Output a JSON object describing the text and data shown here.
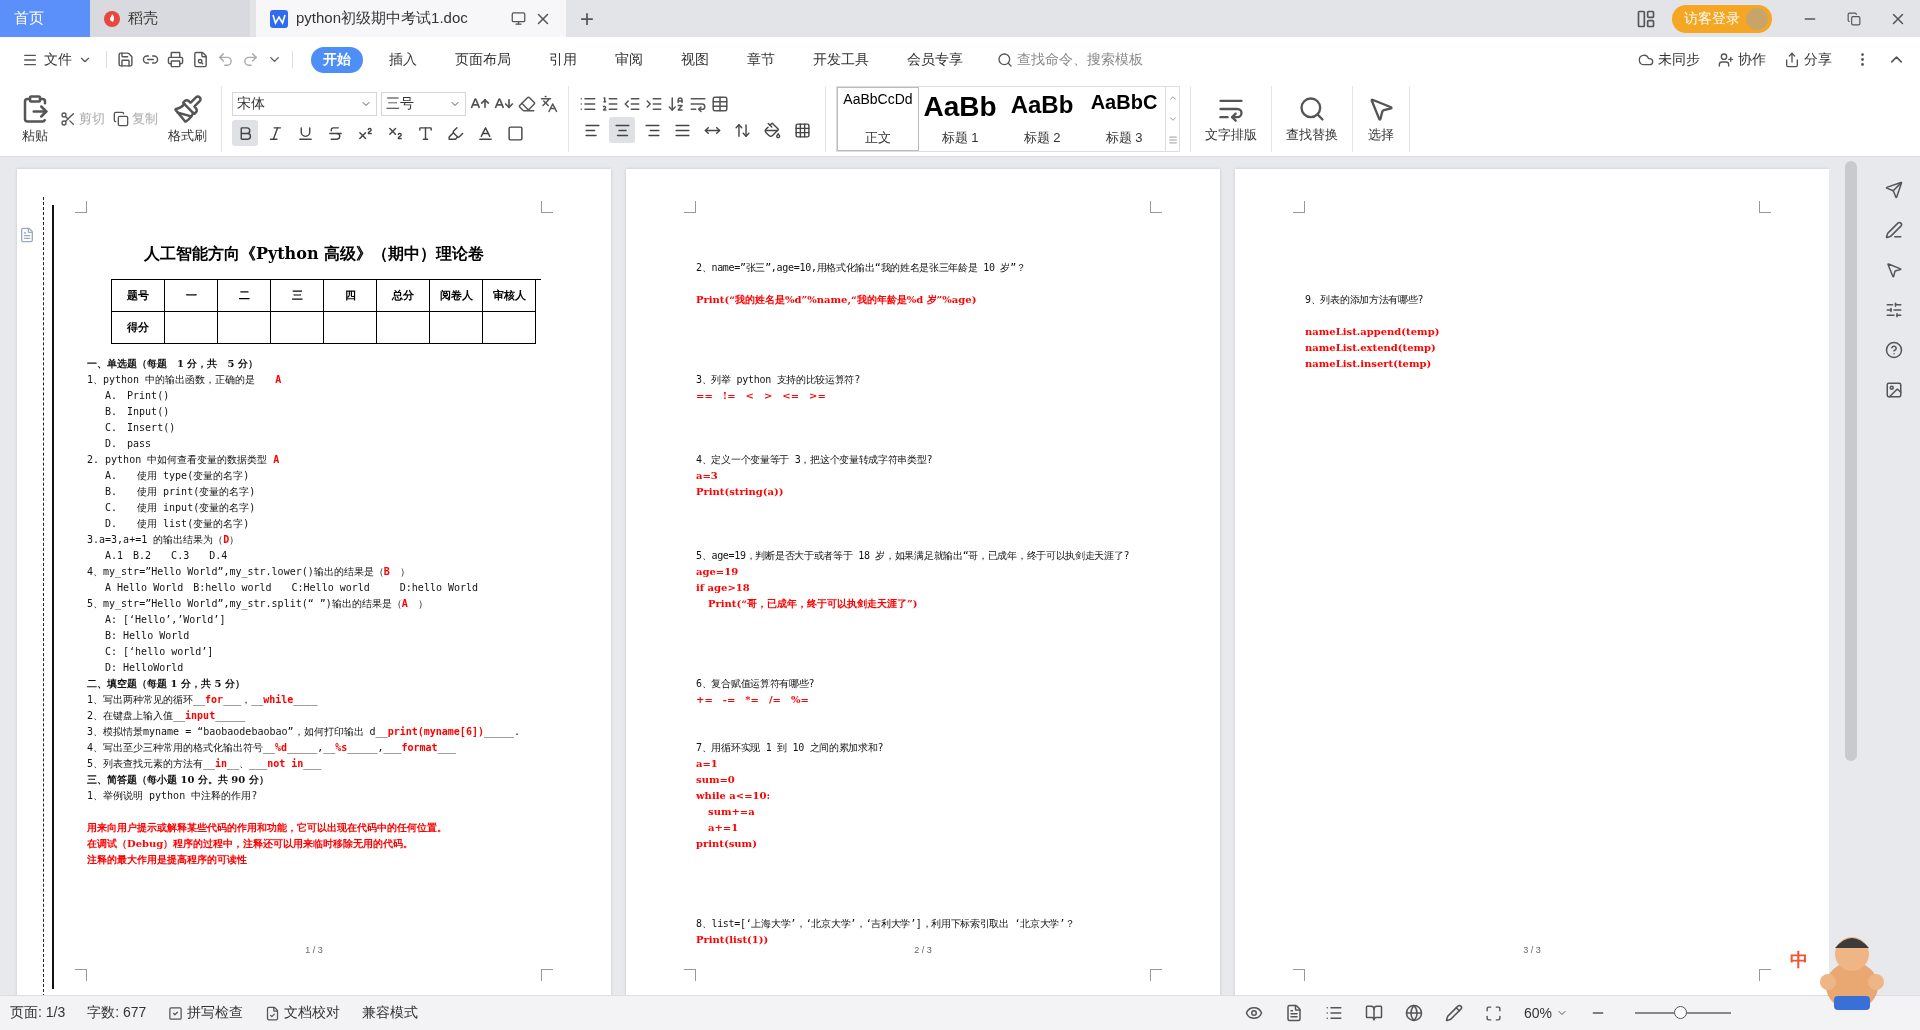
{
  "tabs": [
    {
      "label": "首页",
      "kind": "home",
      "selected": false
    },
    {
      "label": "稻壳",
      "kind": "app",
      "selected": false
    },
    {
      "label": "python初级期中考试1.doc",
      "kind": "doc",
      "selected": true
    }
  ],
  "new_tab": "+",
  "login_button": "访客登录",
  "menu": {
    "file": "文件",
    "items": [
      {
        "label": "开始",
        "selected": true
      },
      {
        "label": "插入",
        "selected": false
      },
      {
        "label": "页面布局",
        "selected": false
      },
      {
        "label": "引用",
        "selected": false
      },
      {
        "label": "审阅",
        "selected": false
      },
      {
        "label": "视图",
        "selected": false
      },
      {
        "label": "章节",
        "selected": false
      },
      {
        "label": "开发工具",
        "selected": false
      },
      {
        "label": "会员专享",
        "selected": false
      }
    ],
    "search_placeholder": "查找命令、搜索模板",
    "actions": [
      {
        "label": "未同步",
        "kind": "sync"
      },
      {
        "label": "协作",
        "kind": "collab"
      },
      {
        "label": "分享",
        "kind": "share"
      }
    ]
  },
  "ribbon": {
    "clipboard": [
      {
        "label": "粘贴",
        "kind": "paste",
        "disabled": false
      },
      {
        "label": "剪切",
        "kind": "cut",
        "disabled": true
      },
      {
        "label": "复制",
        "kind": "copy",
        "disabled": true
      },
      {
        "label": "格式刷",
        "kind": "brush",
        "disabled": false
      }
    ],
    "font": {
      "name": "宋体",
      "size": "三号"
    },
    "font_buttons": [
      {
        "kind": "bold",
        "selected": true
      },
      {
        "kind": "italic",
        "selected": false
      },
      {
        "kind": "underline",
        "selected": false
      },
      {
        "kind": "strike",
        "selected": false
      },
      {
        "kind": "sup",
        "selected": false
      },
      {
        "kind": "sub",
        "selected": false
      },
      {
        "kind": "effect",
        "selected": false
      },
      {
        "kind": "highlight",
        "selected": false
      },
      {
        "kind": "color",
        "selected": false
      },
      {
        "kind": "border",
        "selected": false
      }
    ],
    "paragraph_buttons": [
      {
        "kind": "left",
        "selected": false
      },
      {
        "kind": "center",
        "selected": true
      },
      {
        "kind": "right",
        "selected": false
      },
      {
        "kind": "justify",
        "selected": false
      },
      {
        "kind": "distribute",
        "selected": false
      },
      {
        "kind": "spacing",
        "selected": false
      },
      {
        "kind": "shading",
        "selected": false
      },
      {
        "kind": "borders",
        "selected": false
      }
    ],
    "styles": [
      {
        "preview": "AaBbCcDd",
        "label": "正文",
        "kind": "body",
        "selected": true
      },
      {
        "preview": "AaBb",
        "label": "标题 1",
        "kind": "h1",
        "selected": false
      },
      {
        "preview": "AaBb",
        "label": "标题 2",
        "kind": "h2",
        "selected": false
      },
      {
        "preview": "AaBbC",
        "label": "标题 3",
        "kind": "h3",
        "selected": false
      }
    ],
    "tools": [
      {
        "label": "文字排版",
        "kind": "layout"
      },
      {
        "label": "查找替换",
        "kind": "find"
      },
      {
        "label": "选择",
        "kind": "select"
      }
    ]
  },
  "pages": [
    {
      "number": "1 / 3",
      "binding": true,
      "lines": [
        {
          "kind": "title",
          "text": "人工智能方向《Python 高级》（期中）理论卷"
        },
        {
          "kind": "table",
          "header": [
            "题号",
            "一",
            "二",
            "三",
            "四",
            "总分",
            "阅卷人",
            "审核人"
          ],
          "row_label": "得分"
        },
        {
          "kind": "heading",
          "text": "一、单选题（每题　1 分，共　5 分）"
        },
        {
          "kind": "question",
          "parts": [
            {
              "text": "1、python 中的输出函数，正确的是　　",
              "answer": false
            },
            {
              "text": "A",
              "answer": true
            }
          ]
        },
        {
          "kind": "option",
          "text": "A.　Print()"
        },
        {
          "kind": "option",
          "text": "B.　Input()"
        },
        {
          "kind": "option",
          "text": "C.　Insert()"
        },
        {
          "kind": "option",
          "text": "D.　pass"
        },
        {
          "kind": "question",
          "parts": [
            {
              "text": "2. python 中如何查看变量的数据类型 ",
              "answer": false
            },
            {
              "text": "A",
              "answer": true
            }
          ]
        },
        {
          "kind": "option",
          "text": "A.　　使用 type(变量的名字)"
        },
        {
          "kind": "option",
          "text": "B.　　使用 print(变量的名字)"
        },
        {
          "kind": "option",
          "text": "C.　　使用 input(变量的名字)"
        },
        {
          "kind": "option",
          "text": "D.　　使用 list(变量的名字)"
        },
        {
          "kind": "question",
          "parts": [
            {
              "text": "3.a=3,a+=1 的输出结果为（",
              "answer": false
            },
            {
              "text": "D",
              "answer": true
            },
            {
              "text": "）",
              "answer": false
            }
          ]
        },
        {
          "kind": "option",
          "text": "A.1　B.2　　C.3　　D.4"
        },
        {
          "kind": "question",
          "parts": [
            {
              "text": "4、my_str=”Hello World”,my_str.lower()输出的结果是（",
              "answer": false
            },
            {
              "text": "B",
              "answer": true
            },
            {
              "text": "　）",
              "answer": false
            }
          ]
        },
        {
          "kind": "option",
          "text": "A Hello World　B:hello world　　C:Hello world　　　D:hello World"
        },
        {
          "kind": "question",
          "parts": [
            {
              "text": "5、my_str=”Hello World”,my_str.split(“ ”)输出的结果是（",
              "answer": false
            },
            {
              "text": "A",
              "answer": true
            },
            {
              "text": "　）",
              "answer": false
            }
          ]
        },
        {
          "kind": "option",
          "text": "A: [‘Hello’,’World’]"
        },
        {
          "kind": "option",
          "text": "B: Hello World"
        },
        {
          "kind": "option",
          "text": "C: [‘hello world’]"
        },
        {
          "kind": "option",
          "text": "D: HelloWorld"
        },
        {
          "kind": "heading",
          "text": "二、填空题（每题 1 分，共 5 分）"
        },
        {
          "kind": "question",
          "parts": [
            {
              "text": "1、写出两种常见的循环__",
              "answer": false
            },
            {
              "text": "for",
              "answer": true
            },
            {
              "text": "___，__",
              "answer": false
            },
            {
              "text": "while",
              "answer": true
            },
            {
              "text": "____",
              "answer": false
            }
          ]
        },
        {
          "kind": "question",
          "parts": [
            {
              "text": "2、在键盘上输入值__",
              "answer": false
            },
            {
              "text": "input",
              "answer": true
            },
            {
              "text": "_____",
              "answer": false
            }
          ]
        },
        {
          "kind": "question",
          "parts": [
            {
              "text": "3、模拟情景myname = “baobaodebaobao”，如何打印输出 d__",
              "answer": false
            },
            {
              "text": "print(myname[6])",
              "answer": true
            },
            {
              "text": "_____.",
              "answer": false
            }
          ]
        },
        {
          "kind": "question",
          "parts": [
            {
              "text": "4、写出至少三种常用的格式化输出符号__",
              "answer": false
            },
            {
              "text": "%d",
              "answer": true
            },
            {
              "text": "_____,__",
              "answer": false
            },
            {
              "text": "%s",
              "answer": true
            },
            {
              "text": "_____,___",
              "answer": false
            },
            {
              "text": "format",
              "answer": true
            },
            {
              "text": "___",
              "answer": false
            }
          ]
        },
        {
          "kind": "question",
          "parts": [
            {
              "text": "5、列表查找元素的方法有__",
              "answer": false
            },
            {
              "text": "in",
              "answer": true
            },
            {
              "text": "__、___",
              "answer": false
            },
            {
              "text": "not in",
              "answer": true
            },
            {
              "text": "___",
              "answer": false
            }
          ]
        },
        {
          "kind": "heading",
          "text": "三、简答题（每小题 10 分。共 90 分）"
        },
        {
          "kind": "question",
          "parts": [
            {
              "text": "1、举例说明 python 中注释的作用?",
              "answer": false
            }
          ]
        },
        {
          "kind": "blank"
        },
        {
          "kind": "answer",
          "text": "用来向用户提示或解释某些代码的作用和功能，它可以出现在代码中的任何位置。"
        },
        {
          "kind": "answer",
          "text": "在调试（Debug）程序的过程中，注释还可以用来临时移除无用的代码。"
        },
        {
          "kind": "answer",
          "text": "注释的最大作用是提高程序的可读性"
        }
      ]
    },
    {
      "number": "2 / 3",
      "binding": false,
      "lines": [
        {
          "kind": "blank"
        },
        {
          "kind": "small",
          "text": "2、name=”张三”,age=10,用格式化输出“我的姓名是张三年龄是 10 岁”？"
        },
        {
          "kind": "blank"
        },
        {
          "kind": "answer",
          "text": "Print(“我的姓名是%d”%name,“我的年龄是%d 岁”%age)"
        },
        {
          "kind": "blank"
        },
        {
          "kind": "blank"
        },
        {
          "kind": "blank"
        },
        {
          "kind": "blank"
        },
        {
          "kind": "small",
          "text": "3、列举 python 支持的比较运算符?"
        },
        {
          "kind": "answer",
          "text": "==　!=　<　>　<=　>="
        },
        {
          "kind": "blank"
        },
        {
          "kind": "blank"
        },
        {
          "kind": "blank"
        },
        {
          "kind": "small",
          "text": "4、定义一个变量等于 3，把这个变量转成字符串类型?"
        },
        {
          "kind": "answer",
          "text": "a=3"
        },
        {
          "kind": "answer",
          "text": "Print(string(a))"
        },
        {
          "kind": "blank"
        },
        {
          "kind": "blank"
        },
        {
          "kind": "blank"
        },
        {
          "kind": "small",
          "text": "5、age=19，判断是否大于或者等于 18 岁，如果满足就输出“哥，已成年，终于可以执剑走天涯了?"
        },
        {
          "kind": "answer",
          "text": "age=19"
        },
        {
          "kind": "answer",
          "text": "if age>18"
        },
        {
          "kind": "answer-indented",
          "text": "Print(“哥，已成年，终于可以执剑走天涯了”)"
        },
        {
          "kind": "blank"
        },
        {
          "kind": "blank"
        },
        {
          "kind": "blank"
        },
        {
          "kind": "blank"
        },
        {
          "kind": "small",
          "text": "6、复合赋值运算符有哪些?"
        },
        {
          "kind": "answer",
          "text": "+=　-=　*=　/=　%="
        },
        {
          "kind": "blank"
        },
        {
          "kind": "blank"
        },
        {
          "kind": "small",
          "text": "7、用循环实现 1 到 10 之间的累加求和?"
        },
        {
          "kind": "answer",
          "text": "a=1"
        },
        {
          "kind": "answer",
          "text": "sum=0"
        },
        {
          "kind": "answer",
          "text": "while a<=10:"
        },
        {
          "kind": "answer-indented",
          "text": "sum+=a"
        },
        {
          "kind": "answer-indented",
          "text": "a+=1"
        },
        {
          "kind": "answer",
          "text": "print(sum)"
        },
        {
          "kind": "blank"
        },
        {
          "kind": "blank"
        },
        {
          "kind": "blank"
        },
        {
          "kind": "blank"
        },
        {
          "kind": "small",
          "text": "8、list=[‘上海大学’，‘北京大学’，‘吉利大学’]，利用下标索引取出 ‘北京大学’？"
        },
        {
          "kind": "answer",
          "text": "Print(list(1))"
        }
      ]
    },
    {
      "number": "3 / 3",
      "binding": false,
      "lines": [
        {
          "kind": "blank"
        },
        {
          "kind": "blank"
        },
        {
          "kind": "blank"
        },
        {
          "kind": "small",
          "text": "9、列表的添加方法有哪些?"
        },
        {
          "kind": "blank"
        },
        {
          "kind": "answer",
          "text": "nameList.append(temp)"
        },
        {
          "kind": "answer",
          "text": "nameList.extend(temp)"
        },
        {
          "kind": "answer",
          "text": "nameList.insert(temp)"
        }
      ]
    }
  ],
  "status_bar": {
    "page": "页面: 1/3",
    "words": "字数: 677",
    "spell_check": "拼写检查",
    "proofread": "文档校对",
    "mode": "兼容模式",
    "zoom": "60%",
    "zoom_slider": {
      "level": 0.47
    }
  },
  "ime": "中"
}
